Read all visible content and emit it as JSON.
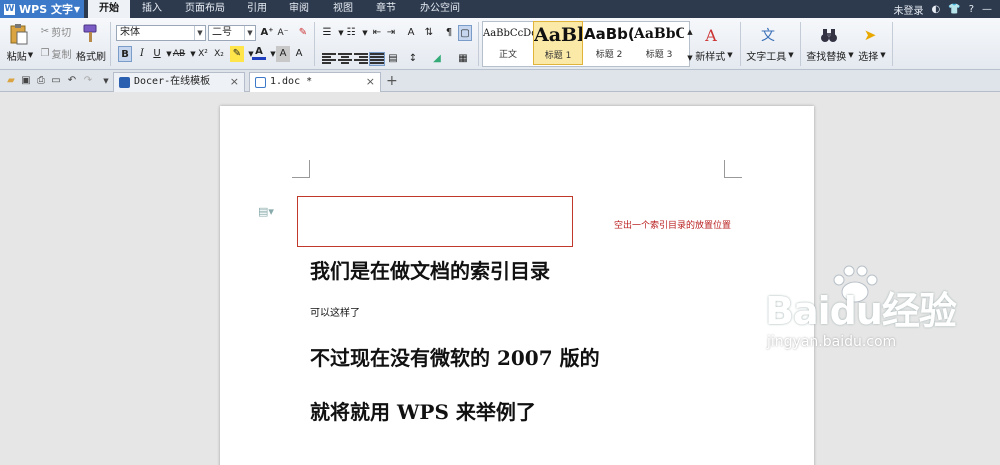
{
  "menubar": {
    "app_label": "WPS 文字",
    "tabs": [
      "开始",
      "插入",
      "页面布局",
      "引用",
      "审阅",
      "视图",
      "章节",
      "办公空间"
    ],
    "active_tab": 0,
    "login": "未登录",
    "help": "?"
  },
  "ribbon": {
    "paste": "粘贴",
    "cut": "剪切",
    "copy": "复制",
    "format_painter": "格式刷",
    "font_name": "宋体",
    "font_size": "二号",
    "bold": "B",
    "italic": "I",
    "underline": "U",
    "strike": "AB",
    "superscript": "X²",
    "subscript": "X₂",
    "font_color_letter": "A",
    "styles": [
      {
        "sample": "AaBbCcDd",
        "name": "正文"
      },
      {
        "sample": "AaBl",
        "name": "标题 1"
      },
      {
        "sample": "AaBb(",
        "name": "标题 2"
      },
      {
        "sample": "AaBbC",
        "name": "标题 3"
      }
    ],
    "new_style": "新样式",
    "text_tools": "文字工具",
    "find_replace": "查找替换",
    "select": "选择"
  },
  "tabs": [
    {
      "label": "Docer-在线模板",
      "close": "×"
    },
    {
      "label": "1.doc *",
      "close": "×"
    }
  ],
  "document": {
    "annotation": "空出一个索引目录的放置位置",
    "heading1": "我们是在做文档的索引目录",
    "paragraph": "可以这样了",
    "heading2": "不过现在没有微软的 2007 版的",
    "heading3": "就将就用 WPS 来举例了"
  },
  "watermark": {
    "main": "Baidu经验",
    "sub": "jingyan.baidu.com"
  },
  "colors": {
    "menubar_bg": "#2d3a4e",
    "app_button": "#3c79c8",
    "annotation_red": "#c0392b"
  }
}
